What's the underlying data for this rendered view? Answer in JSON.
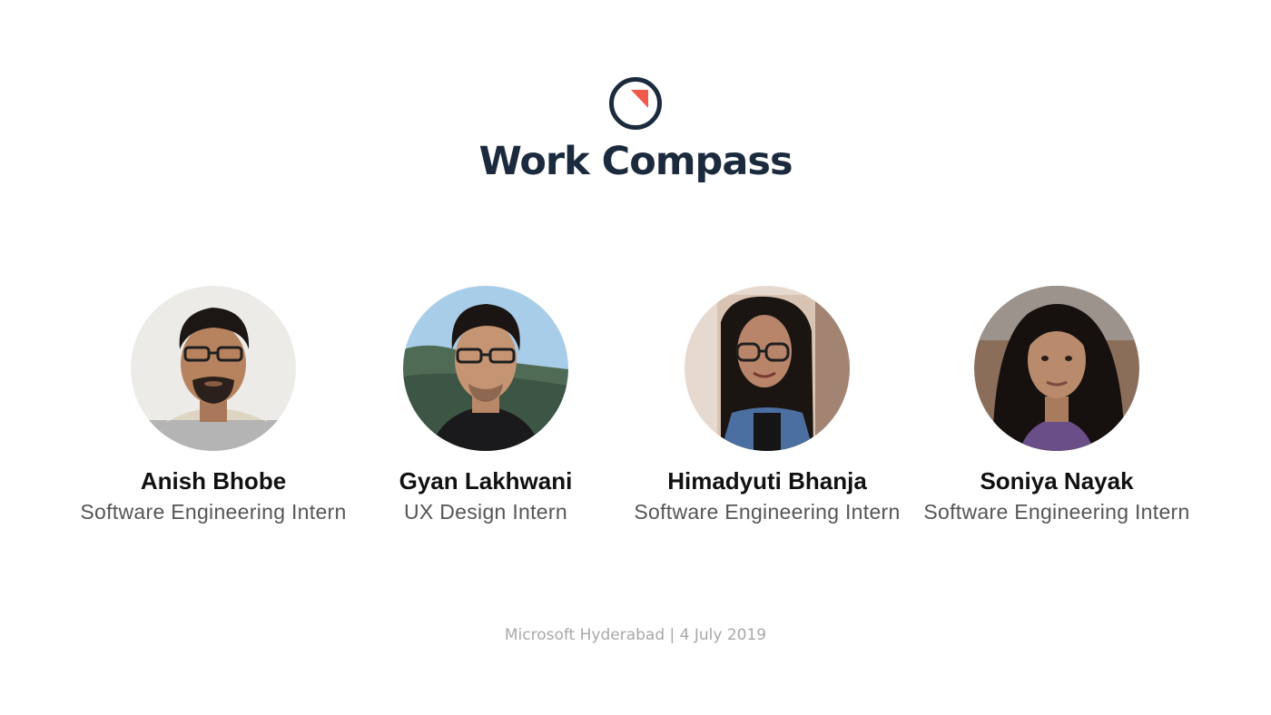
{
  "header": {
    "logo_icon": "compass-icon",
    "title": "Work Compass"
  },
  "team": [
    {
      "name": "Anish Bhobe",
      "role": "Software Engineering Intern",
      "photo_icon": "avatar-photo"
    },
    {
      "name": "Gyan Lakhwani",
      "role": "UX Design Intern",
      "photo_icon": "avatar-photo"
    },
    {
      "name": "Himadyuti Bhanja",
      "role": "Software Engineering Intern",
      "photo_icon": "avatar-photo"
    },
    {
      "name": "Soniya Nayak",
      "role": "Software Engineering Intern",
      "photo_icon": "avatar-photo"
    }
  ],
  "footer": {
    "text": "Microsoft Hyderabad | 4 July 2019"
  },
  "colors": {
    "title": "#1b2a3d",
    "accent": "#f05a4a",
    "footer": "#a8a8a8"
  }
}
